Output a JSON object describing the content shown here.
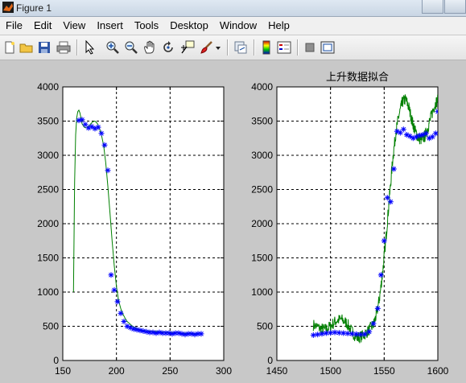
{
  "window": {
    "title": "Figure 1"
  },
  "menu": [
    "File",
    "Edit",
    "View",
    "Insert",
    "Tools",
    "Desktop",
    "Window",
    "Help"
  ],
  "toolbar_icons": [
    "new-figure-icon",
    "open-file-icon",
    "save-icon",
    "print-icon",
    "edit-plot-arrow-icon",
    "zoom-in-icon",
    "zoom-out-icon",
    "pan-hand-icon",
    "rotate-3d-icon",
    "data-cursor-icon",
    "brush-icon",
    "brush-dropdown-icon",
    "link-plot-icon",
    "colorbar-icon",
    "legend-icon",
    "hide-plot-tools-icon",
    "show-plot-tools-icon"
  ],
  "colors": {
    "line": "#008000",
    "markers": "#0000ff",
    "axes_bg": "#ffffff",
    "figure_bg": "#c8c8c8"
  },
  "chart_data": [
    {
      "type": "line",
      "title": "",
      "xlim": [
        150,
        300
      ],
      "ylim": [
        0,
        4000
      ],
      "xticks": [
        150,
        200,
        250,
        300
      ],
      "yticks": [
        0,
        500,
        1000,
        1500,
        2000,
        2500,
        3000,
        3500,
        4000
      ],
      "grid": true,
      "series": [
        {
          "style": "line",
          "color": "#008000",
          "x": [
            160,
            161,
            162,
            163,
            164,
            165,
            166,
            167,
            168,
            170,
            172,
            174,
            176,
            178,
            180,
            182,
            184,
            186,
            188,
            190,
            192,
            194,
            196,
            198,
            200,
            202,
            204,
            206,
            208,
            210,
            215,
            220,
            225,
            230,
            240,
            250,
            260,
            270,
            280
          ],
          "y": [
            1000,
            2600,
            3300,
            3550,
            3640,
            3660,
            3620,
            3540,
            3460,
            3410,
            3400,
            3420,
            3460,
            3490,
            3500,
            3470,
            3400,
            3300,
            3150,
            2900,
            2550,
            2150,
            1750,
            1380,
            1080,
            880,
            760,
            680,
            620,
            570,
            500,
            460,
            440,
            430,
            420,
            410,
            400,
            395,
            390
          ]
        },
        {
          "style": "markers",
          "marker": "*",
          "color": "#0000ff",
          "x": [
            165,
            168,
            171,
            174,
            177,
            180,
            183,
            186,
            189,
            192,
            195,
            198,
            201,
            204,
            207,
            210,
            213,
            216,
            219,
            222,
            225,
            228,
            231,
            234,
            237,
            240,
            243,
            246,
            249,
            252,
            255,
            258,
            261,
            264,
            267,
            270,
            273,
            276,
            279
          ],
          "y": [
            3510,
            3520,
            3450,
            3400,
            3420,
            3390,
            3410,
            3320,
            3150,
            2780,
            1250,
            1030,
            860,
            690,
            570,
            500,
            480,
            460,
            450,
            440,
            430,
            420,
            410,
            410,
            400,
            410,
            400,
            400,
            400,
            390,
            400,
            400,
            390,
            380,
            390,
            390,
            380,
            390,
            390
          ]
        }
      ]
    },
    {
      "type": "line",
      "title": "上升数据拟合",
      "xlim": [
        1450,
        1600
      ],
      "ylim": [
        0,
        4000
      ],
      "xticks": [
        1450,
        1500,
        1550,
        1600
      ],
      "yticks": [
        0,
        500,
        1000,
        1500,
        2000,
        2500,
        3000,
        3500,
        4000
      ],
      "grid": true,
      "series": [
        {
          "style": "noisy-line",
          "color": "#008000",
          "x": [
            1484,
            1490,
            1495,
            1500,
            1505,
            1510,
            1515,
            1520,
            1525,
            1530,
            1535,
            1540,
            1543,
            1546,
            1549,
            1552,
            1555,
            1558,
            1561,
            1564,
            1567,
            1570,
            1573,
            1576,
            1579,
            1582,
            1585,
            1588,
            1591,
            1594,
            1597,
            1600
          ],
          "y": [
            520,
            470,
            450,
            500,
            580,
            600,
            550,
            420,
            330,
            360,
            430,
            520,
            680,
            950,
            1350,
            1850,
            2400,
            2950,
            3350,
            3600,
            3780,
            3820,
            3700,
            3500,
            3350,
            3250,
            3230,
            3280,
            3420,
            3580,
            3730,
            3820
          ]
        },
        {
          "style": "markers",
          "marker": "*",
          "color": "#0000ff",
          "x": [
            1484,
            1488,
            1492,
            1496,
            1500,
            1504,
            1508,
            1512,
            1516,
            1520,
            1524,
            1528,
            1532,
            1536,
            1540,
            1544,
            1547,
            1550,
            1553,
            1556,
            1559,
            1562,
            1565,
            1568,
            1571,
            1574,
            1577,
            1580,
            1583,
            1586,
            1589,
            1592,
            1595,
            1598,
            1600
          ],
          "y": [
            370,
            380,
            390,
            400,
            405,
            410,
            405,
            400,
            395,
            390,
            385,
            380,
            385,
            420,
            540,
            760,
            1250,
            1750,
            2380,
            2320,
            2800,
            3350,
            3330,
            3380,
            3300,
            3280,
            3250,
            3270,
            3290,
            3300,
            3320,
            3250,
            3270,
            3320,
            3640
          ]
        }
      ]
    }
  ]
}
